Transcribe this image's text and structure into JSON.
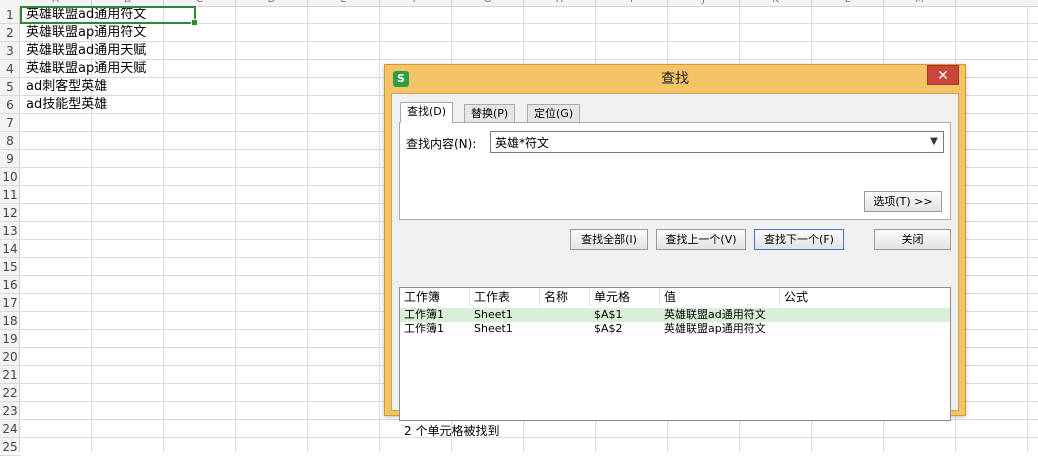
{
  "sheet": {
    "columns": [
      "A",
      "B",
      "C",
      "D",
      "E",
      "F",
      "G",
      "H",
      "I",
      "J",
      "K",
      "L",
      "M"
    ],
    "rows": [
      "1",
      "2",
      "3",
      "4",
      "5",
      "6",
      "7",
      "8",
      "9",
      "10",
      "11",
      "12",
      "13",
      "14",
      "15",
      "16",
      "17",
      "18",
      "19",
      "20",
      "21",
      "22",
      "23",
      "24",
      "25"
    ],
    "cells": [
      "英雄联盟ad通用符文",
      "英雄联盟ap通用符文",
      "英雄联盟ad通用天赋",
      "英雄联盟ap通用天赋",
      "ad刺客型英雄",
      "ad技能型英雄"
    ]
  },
  "dialog": {
    "title": "查找",
    "app_icon_letter": "S",
    "close_glyph": "✕",
    "tabs": [
      {
        "label": "查找(D)",
        "active": true
      },
      {
        "label": "替换(P)",
        "active": false
      },
      {
        "label": "定位(G)",
        "active": false
      }
    ],
    "find_label": "查找内容(N):",
    "find_value": "英雄*符文",
    "options_button": "选项(T) >>",
    "buttons": {
      "find_all": "查找全部(I)",
      "find_prev": "查找上一个(V)",
      "find_next": "查找下一个(F)",
      "close": "关闭"
    },
    "results": {
      "headers": [
        "工作簿",
        "工作表",
        "名称",
        "单元格",
        "值",
        "公式"
      ],
      "rows": [
        {
          "workbook": "工作簿1",
          "sheet": "Sheet1",
          "name": "",
          "cell": "$A$1",
          "value": "英雄联盟ad通用符文",
          "formula": "",
          "selected": true
        },
        {
          "workbook": "工作簿1",
          "sheet": "Sheet1",
          "name": "",
          "cell": "$A$2",
          "value": "英雄联盟ap通用符文",
          "formula": "",
          "selected": false
        }
      ]
    },
    "status": "2 个单元格被找到"
  },
  "colors": {
    "dialog_frame": "#f3c366",
    "close_button": "#c9463d",
    "active_cell_border": "#2f8a2f",
    "selected_row": "#d9efd7"
  }
}
